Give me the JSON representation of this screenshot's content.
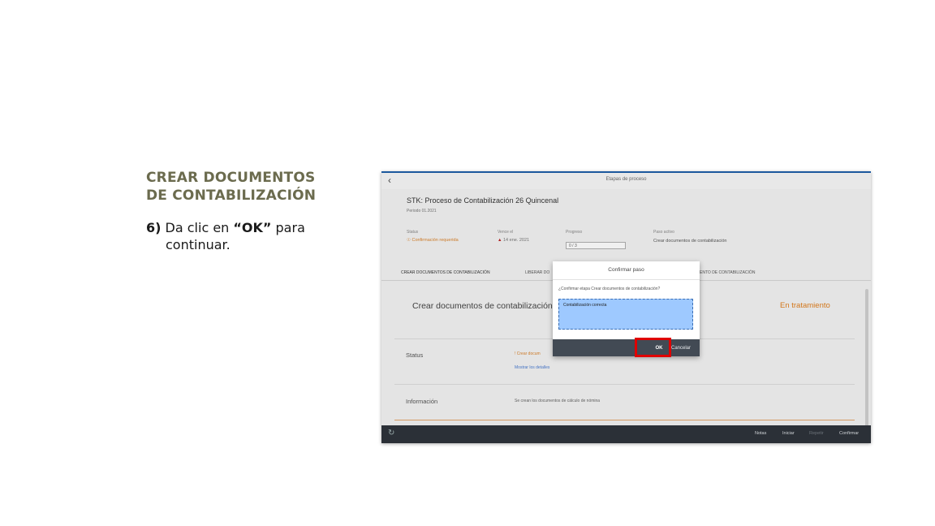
{
  "instruction": {
    "heading_line1": "CREAR DOCUMENTOS",
    "heading_line2": "DE CONTABILIZACIÓN",
    "step_number": "6)",
    "step_text_before": "Da clic en ",
    "step_bold": "“OK”",
    "step_text_after": " para",
    "step_text_line2": "continuar."
  },
  "app": {
    "page_title": "Etapas de proceso",
    "process_title": "STK: Proceso de Contabilización 26 Quincenal",
    "period": "Periodo 01.2021",
    "status_label": "Status",
    "status_value": "Confirmación requerida",
    "due_label": "Vence el",
    "due_value": "14 ene. 2021",
    "progress_label": "Progreso",
    "progress_value": "0 / 3",
    "active_step_label": "Paso activo",
    "active_step_value": "Crear documentos de contabilización",
    "tabs": [
      "CREAR DOCUMENTOS DE CONTABILIZACIÓN",
      "LIBERAR DO",
      "ENTO DE CONTABILIZACIÓN"
    ],
    "card_title": "Crear documentos de contabilización",
    "card_status": "En tratamiento",
    "rows": {
      "status_label": "Status",
      "status_value": "Crear docum",
      "status_link": "Mostrar los detalles",
      "info_label": "Información",
      "info_value": "Se crean los documentos de cálculo de nómina"
    },
    "footer": {
      "buttons": [
        "Notas",
        "Iniciar",
        "Repetir",
        "Confirmar"
      ],
      "disabled": [
        "Repetir"
      ]
    }
  },
  "dialog": {
    "title": "Confirmar paso",
    "question": "¿Confirmar etapa Crear documentos de contabilización?",
    "comment_value": "Contabilización correcta",
    "ok_label": "OK",
    "cancel_label": "Cancelar"
  },
  "colors": {
    "heading": "#6b6b4e",
    "highlight": "#e00000",
    "status_orange": "#e07f1e",
    "footer_bg": "#2b3037"
  }
}
